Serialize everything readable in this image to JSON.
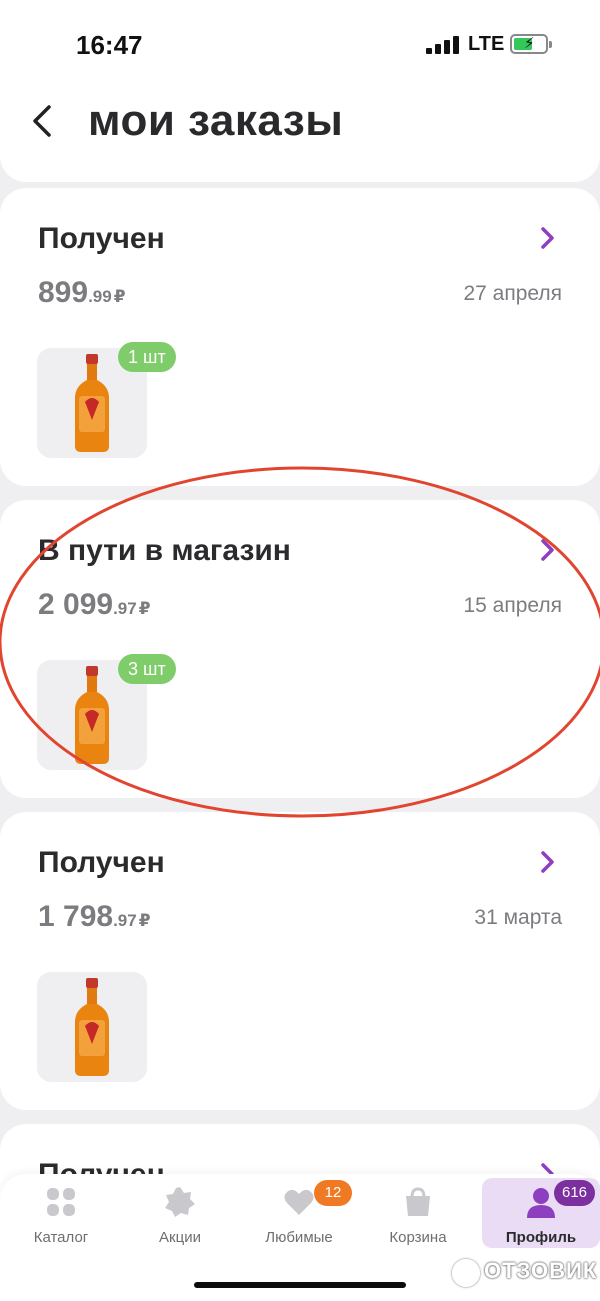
{
  "status_bar": {
    "time": "16:47",
    "network": "LTE"
  },
  "header": {
    "title": "мои заказы"
  },
  "orders": [
    {
      "status": "Получен",
      "price_main": "899",
      "price_kop": ".99",
      "currency": "₽",
      "date": "27 апреля",
      "quantity": "1 шт"
    },
    {
      "status": "В пути в магазин",
      "price_main": "2 099",
      "price_kop": ".97",
      "currency": "₽",
      "date": "15 апреля",
      "quantity": "3 шт"
    },
    {
      "status": "Получен",
      "price_main": "1 798",
      "price_kop": ".97",
      "currency": "₽",
      "date": "31 марта",
      "quantity": ""
    },
    {
      "status": "Получен"
    }
  ],
  "tab_bar": {
    "items": [
      {
        "label": "Каталог",
        "icon": "grid-icon"
      },
      {
        "label": "Акции",
        "icon": "badge-star-icon"
      },
      {
        "label": "Любимые",
        "icon": "heart-icon",
        "badge": "12"
      },
      {
        "label": "Корзина",
        "icon": "shopping-bag-icon"
      },
      {
        "label": "Профиль",
        "icon": "user-icon",
        "badge": "616",
        "active": true
      }
    ]
  },
  "watermark": "ОТЗОВИК",
  "colors": {
    "accent": "#8e3fbf",
    "badge_green": "#7fcc6a",
    "badge_orange": "#f07a23",
    "badge_purple": "#7c2f9e",
    "annotation_red": "#e2452f",
    "active_tab": "#eadcf5"
  }
}
